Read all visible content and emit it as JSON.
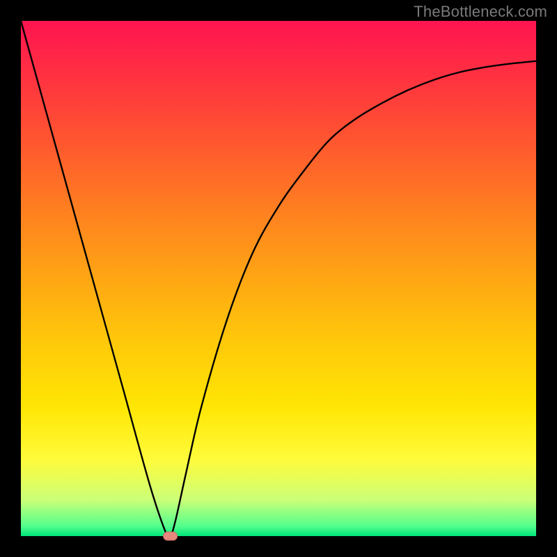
{
  "watermark": "TheBottleneck.com",
  "colors": {
    "frame": "#000000",
    "curve": "#000000",
    "marker_fill": "#e6887e",
    "marker_stroke": "#c96a60"
  },
  "chart_data": {
    "type": "line",
    "title": "",
    "xlabel": "",
    "ylabel": "",
    "xlim": [
      0,
      100
    ],
    "ylim": [
      0,
      100
    ],
    "grid": false,
    "legend": false,
    "series": [
      {
        "name": "bottleneck-curve",
        "x": [
          0,
          5,
          10,
          15,
          20,
          25,
          28,
          29,
          30,
          32,
          35,
          40,
          45,
          50,
          55,
          60,
          65,
          70,
          75,
          80,
          85,
          90,
          95,
          100
        ],
        "values": [
          100,
          82,
          64,
          46,
          28,
          10,
          1,
          0,
          3,
          12,
          25,
          42,
          55,
          64,
          71,
          77,
          81,
          84,
          86.5,
          88.5,
          90,
          91,
          91.7,
          92.2
        ]
      }
    ],
    "marker": {
      "name": "optimal-point",
      "x": 29,
      "y": 0,
      "shape": "rounded-rect"
    },
    "gradient_stops": [
      {
        "pos": 0,
        "color": "#ff1450"
      },
      {
        "pos": 10,
        "color": "#ff2f42"
      },
      {
        "pos": 22,
        "color": "#ff5231"
      },
      {
        "pos": 35,
        "color": "#ff7a22"
      },
      {
        "pos": 48,
        "color": "#ffa015"
      },
      {
        "pos": 62,
        "color": "#ffc80a"
      },
      {
        "pos": 75,
        "color": "#ffe604"
      },
      {
        "pos": 85,
        "color": "#fffb3a"
      },
      {
        "pos": 93,
        "color": "#cbff78"
      },
      {
        "pos": 98,
        "color": "#54ff8c"
      },
      {
        "pos": 100,
        "color": "#00e47a"
      }
    ]
  }
}
